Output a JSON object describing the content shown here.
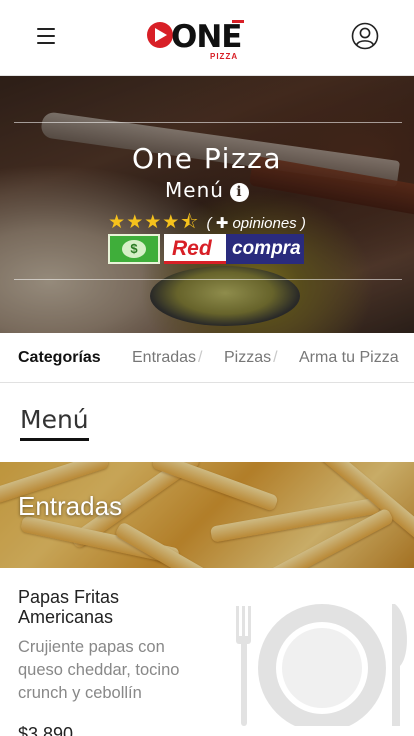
{
  "header": {
    "logo_text": "ONE",
    "logo_sub": "PIZZA"
  },
  "hero": {
    "title": "One Pizza",
    "subtitle": "Menú",
    "rating_value": 4.5,
    "opinions_prefix": "(",
    "opinions_plus": "✚",
    "opinions_label": "opiniones",
    "opinions_suffix": ")",
    "payments": {
      "cash_symbol": "$",
      "redcompra_left": "Red",
      "redcompra_right": "compra"
    }
  },
  "categories": {
    "title": "Categorías",
    "items": [
      {
        "label": "Entradas",
        "sep": "/"
      },
      {
        "label": "Pizzas",
        "sep": "/"
      },
      {
        "label": "Arma tu Pizza",
        "sep": ""
      }
    ]
  },
  "section": {
    "title": "Menú"
  },
  "banner": {
    "title": "Entradas"
  },
  "product": {
    "name": "Papas Fritas Americanas",
    "description": "Crujiente papas con queso cheddar, tocino crunch y cebollín",
    "price": "$3.890"
  },
  "colors": {
    "accent_red": "#d81f26",
    "star": "#f6c21c",
    "redcompra_blue": "#2a2b7d",
    "cash_green": "#3fae3a"
  }
}
